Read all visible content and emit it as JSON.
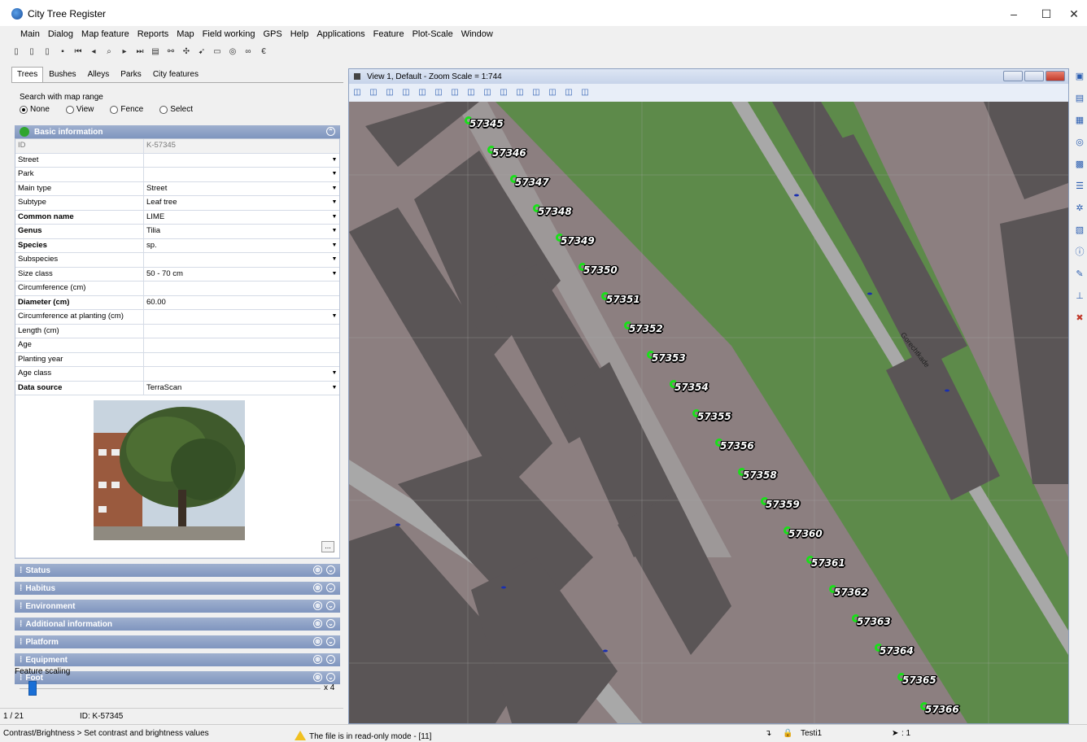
{
  "window": {
    "title": "City Tree Register"
  },
  "menu": [
    "Main",
    "Dialog",
    "Map feature",
    "Reports",
    "Map",
    "Field working",
    "GPS",
    "Help",
    "Applications",
    "Feature",
    "Plot-Scale",
    "Window"
  ],
  "toolbar_icons": [
    "new-icon",
    "new-alt-icon",
    "open-icon",
    "save-icon",
    "first-icon",
    "prev-icon",
    "find-icon",
    "next-icon",
    "last-icon",
    "list-icon",
    "link-icon",
    "move-icon",
    "cursor-icon",
    "rect-icon",
    "circle-icon",
    "infinity-icon",
    "euro-icon"
  ],
  "left": {
    "tabs": [
      "Trees",
      "Bushes",
      "Alleys",
      "Parks",
      "City features"
    ],
    "search_label": "Search with map range",
    "search_options": [
      {
        "label": "None",
        "selected": true
      },
      {
        "label": "View",
        "selected": false
      },
      {
        "label": "Fence",
        "selected": false
      },
      {
        "label": "Select",
        "selected": false
      }
    ],
    "basic_title": "Basic information",
    "fields": [
      {
        "label": "ID",
        "value": "K-57345",
        "bold": false,
        "readonly": true,
        "dropdown": false
      },
      {
        "label": "Street",
        "value": "",
        "bold": false,
        "readonly": false,
        "dropdown": true
      },
      {
        "label": "Park",
        "value": "",
        "bold": false,
        "readonly": false,
        "dropdown": true
      },
      {
        "label": "Main type",
        "value": "Street",
        "bold": false,
        "readonly": false,
        "dropdown": true
      },
      {
        "label": "Subtype",
        "value": "Leaf tree",
        "bold": false,
        "readonly": false,
        "dropdown": true
      },
      {
        "label": "Common name",
        "value": "LIME",
        "bold": true,
        "readonly": false,
        "dropdown": true
      },
      {
        "label": "Genus",
        "value": "Tilia",
        "bold": true,
        "readonly": false,
        "dropdown": true
      },
      {
        "label": "Species",
        "value": "sp.",
        "bold": true,
        "readonly": false,
        "dropdown": true
      },
      {
        "label": "Subspecies",
        "value": "",
        "bold": false,
        "readonly": false,
        "dropdown": true
      },
      {
        "label": "Size class",
        "value": "50 - 70 cm",
        "bold": false,
        "readonly": false,
        "dropdown": true
      },
      {
        "label": "Circumference (cm)",
        "value": "",
        "bold": false,
        "readonly": false,
        "dropdown": false
      },
      {
        "label": "Diameter (cm)",
        "value": "60.00",
        "bold": true,
        "readonly": false,
        "dropdown": false
      },
      {
        "label": "Circumference at planting  (cm)",
        "value": "",
        "bold": false,
        "readonly": false,
        "dropdown": true
      },
      {
        "label": "Length (cm)",
        "value": "",
        "bold": false,
        "readonly": false,
        "dropdown": false
      },
      {
        "label": "Age",
        "value": "",
        "bold": false,
        "readonly": false,
        "dropdown": false
      },
      {
        "label": "Planting year",
        "value": "",
        "bold": false,
        "readonly": false,
        "dropdown": false
      },
      {
        "label": "Age class",
        "value": "",
        "bold": false,
        "readonly": false,
        "dropdown": true
      },
      {
        "label": "Data source",
        "value": "TerraScan",
        "bold": true,
        "readonly": false,
        "dropdown": true
      }
    ],
    "more_button": "...",
    "sections": [
      "Status",
      "Habitus",
      "Environment",
      "Additional information",
      "Platform",
      "Equipment",
      "Foot"
    ],
    "scaling_label": "Feature scaling",
    "scaling_max": "x 4",
    "scaling_value": 0.03,
    "record_pos": "1 / 21",
    "record_id": "ID: K-57345"
  },
  "map": {
    "title": "View 1, Default - Zoom Scale = 1:744",
    "street_name": "Gorechtkade",
    "trees": [
      "57345",
      "57346",
      "57347",
      "57348",
      "57349",
      "57350",
      "57351",
      "57352",
      "57353",
      "57354",
      "57355",
      "57356",
      "57358",
      "57359",
      "57360",
      "57361",
      "57362",
      "57363",
      "57364",
      "57365",
      "57366"
    ],
    "colors": {
      "background": "#8c7f80",
      "buildings": "#5a5556",
      "park": "#5d8a4a",
      "road": "#a8a8a8",
      "tree_marker": "#19e019"
    }
  },
  "status": {
    "left": "Contrast/Brightness > Set contrast and brightness values",
    "message": "The file is in read-only mode - [11]",
    "user": "Testi1",
    "cursor": ": 1"
  }
}
